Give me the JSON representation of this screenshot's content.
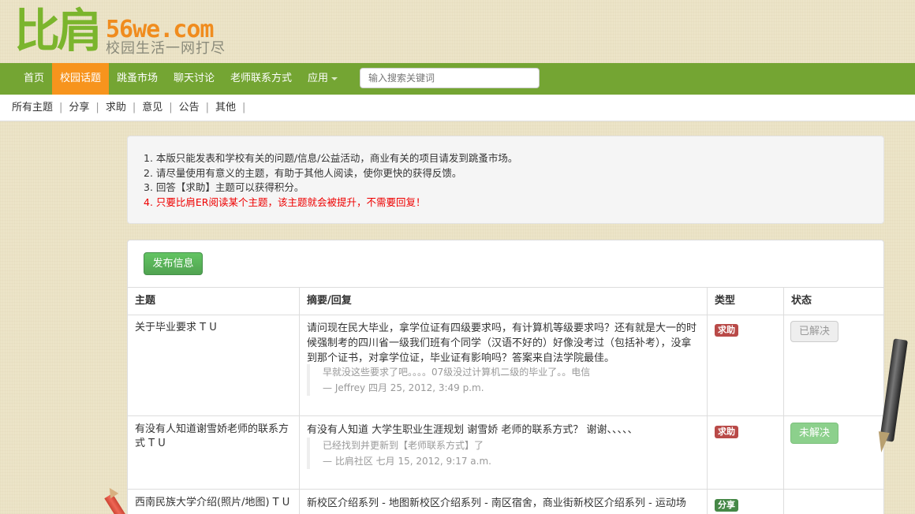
{
  "logo": {
    "cn": "比肩",
    "en": "56we.com",
    "slogan": "校园生活一网打尽"
  },
  "nav": {
    "items": [
      {
        "label": "首页"
      },
      {
        "label": "校园话题"
      },
      {
        "label": "跳蚤市场"
      },
      {
        "label": "聊天讨论"
      },
      {
        "label": "老师联系方式"
      },
      {
        "label": "应用"
      }
    ],
    "active_index": 1,
    "search_placeholder": "输入搜索关键词"
  },
  "subnav": {
    "items": [
      "所有主题",
      "分享",
      "求助",
      "意见",
      "公告",
      "其他"
    ]
  },
  "notice": {
    "lines": [
      "1. 本版只能发表和学校有关的问题/信息/公益活动，商业有关的项目请发到跳蚤市场。",
      "2. 请尽量使用有意义的主题，有助于其他人阅读，使你更快的获得反馈。",
      "3. 回答【求助】主题可以获得积分。",
      "4. 只要比肩ER阅读某个主题，该主题就会被提升，不需要回复！"
    ]
  },
  "panel": {
    "publish_button": "发布信息",
    "headers": {
      "topic": "主题",
      "summary": "摘要/回复",
      "type": "类型",
      "status": "状态"
    },
    "rows": [
      {
        "topic": "关于毕业要求 T U",
        "summary": [
          "请问现在民大毕业，拿学位证有四级要求吗，有计算机等级要求吗？还有就是大一的时",
          "候强制考的四川省一级我们班有个同学（汉语不好的）好像没考过（包括补考），没拿",
          "到那个证书，对拿学位证，毕业证有影响吗？答案来自法学院最佳。"
        ],
        "reply": "早就没这些要求了吧。。。。07级没过计算机二级的毕业了。。电信",
        "reply_meta": "— Jeffrey 四月 25, 2012, 3:49 p.m.",
        "type": "求助",
        "status": "已解决"
      },
      {
        "topic": [
          "有没有人知道谢雪娇老师的联系方",
          "式 T U"
        ],
        "summary": [
          "有没有人知道 大学生职业生涯规划 谢雪娇 老师的联系方式？ 谢谢、、、、、"
        ],
        "reply": "已经找到并更新到【老师联系方式】了",
        "reply_meta": "— 比肩社区 七月 15, 2012, 9:17 a.m.",
        "type": "求助",
        "status": "未解决"
      },
      {
        "topic": "西南民族大学介绍(照片/地图) T U",
        "summary": [
          "新校区介绍系列 - 地图新校区介绍系列 - 南区宿舍，商业街新校区介绍系列 - 运动场"
        ],
        "type": "分享"
      }
    ]
  },
  "colors": {
    "nav_bg": "#74a533",
    "nav_active": "#f7941d",
    "logo_green": "#7bb52d",
    "logo_orange": "#f08c1e"
  }
}
